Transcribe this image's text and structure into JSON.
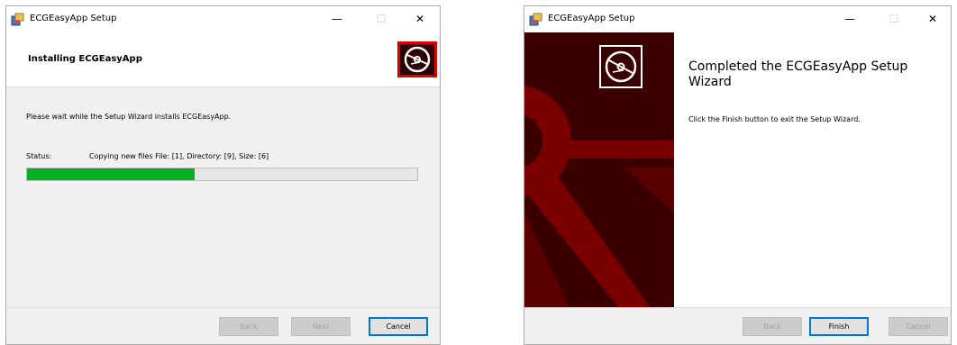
{
  "install_window": {
    "title": "ECGEasyApp Setup",
    "header_title": "Installing ECGEasyApp",
    "message": "Please wait while the Setup Wizard installs ECGEasyApp.",
    "status_label": "Status:",
    "status_value": "Copying new files File: [1],  Directory: [9],  Size: [6]",
    "progress_fraction": 0.43,
    "buttons": {
      "back": "Back",
      "next": "Next",
      "cancel": "Cancel"
    },
    "controls": {
      "minimize": "—",
      "maximize": "☐",
      "close": "✕"
    }
  },
  "complete_window": {
    "title": "ECGEasyApp Setup",
    "heading": "Completed the ECGEasyApp Setup Wizard",
    "message": "Click the Finish button to exit the Setup Wizard.",
    "buttons": {
      "back": "Back",
      "finish": "Finish",
      "cancel": "Cancel"
    },
    "controls": {
      "minimize": "—",
      "maximize": "☐",
      "close": "✕"
    }
  },
  "colors": {
    "progress_fill": "#06b025",
    "banner_dark": "#3a0000",
    "banner_red": "#7a0000",
    "logo_red": "#d90000"
  },
  "icons": [
    "setup-app-icon",
    "disc-logo-icon",
    "minimize-icon",
    "maximize-icon",
    "close-icon"
  ]
}
